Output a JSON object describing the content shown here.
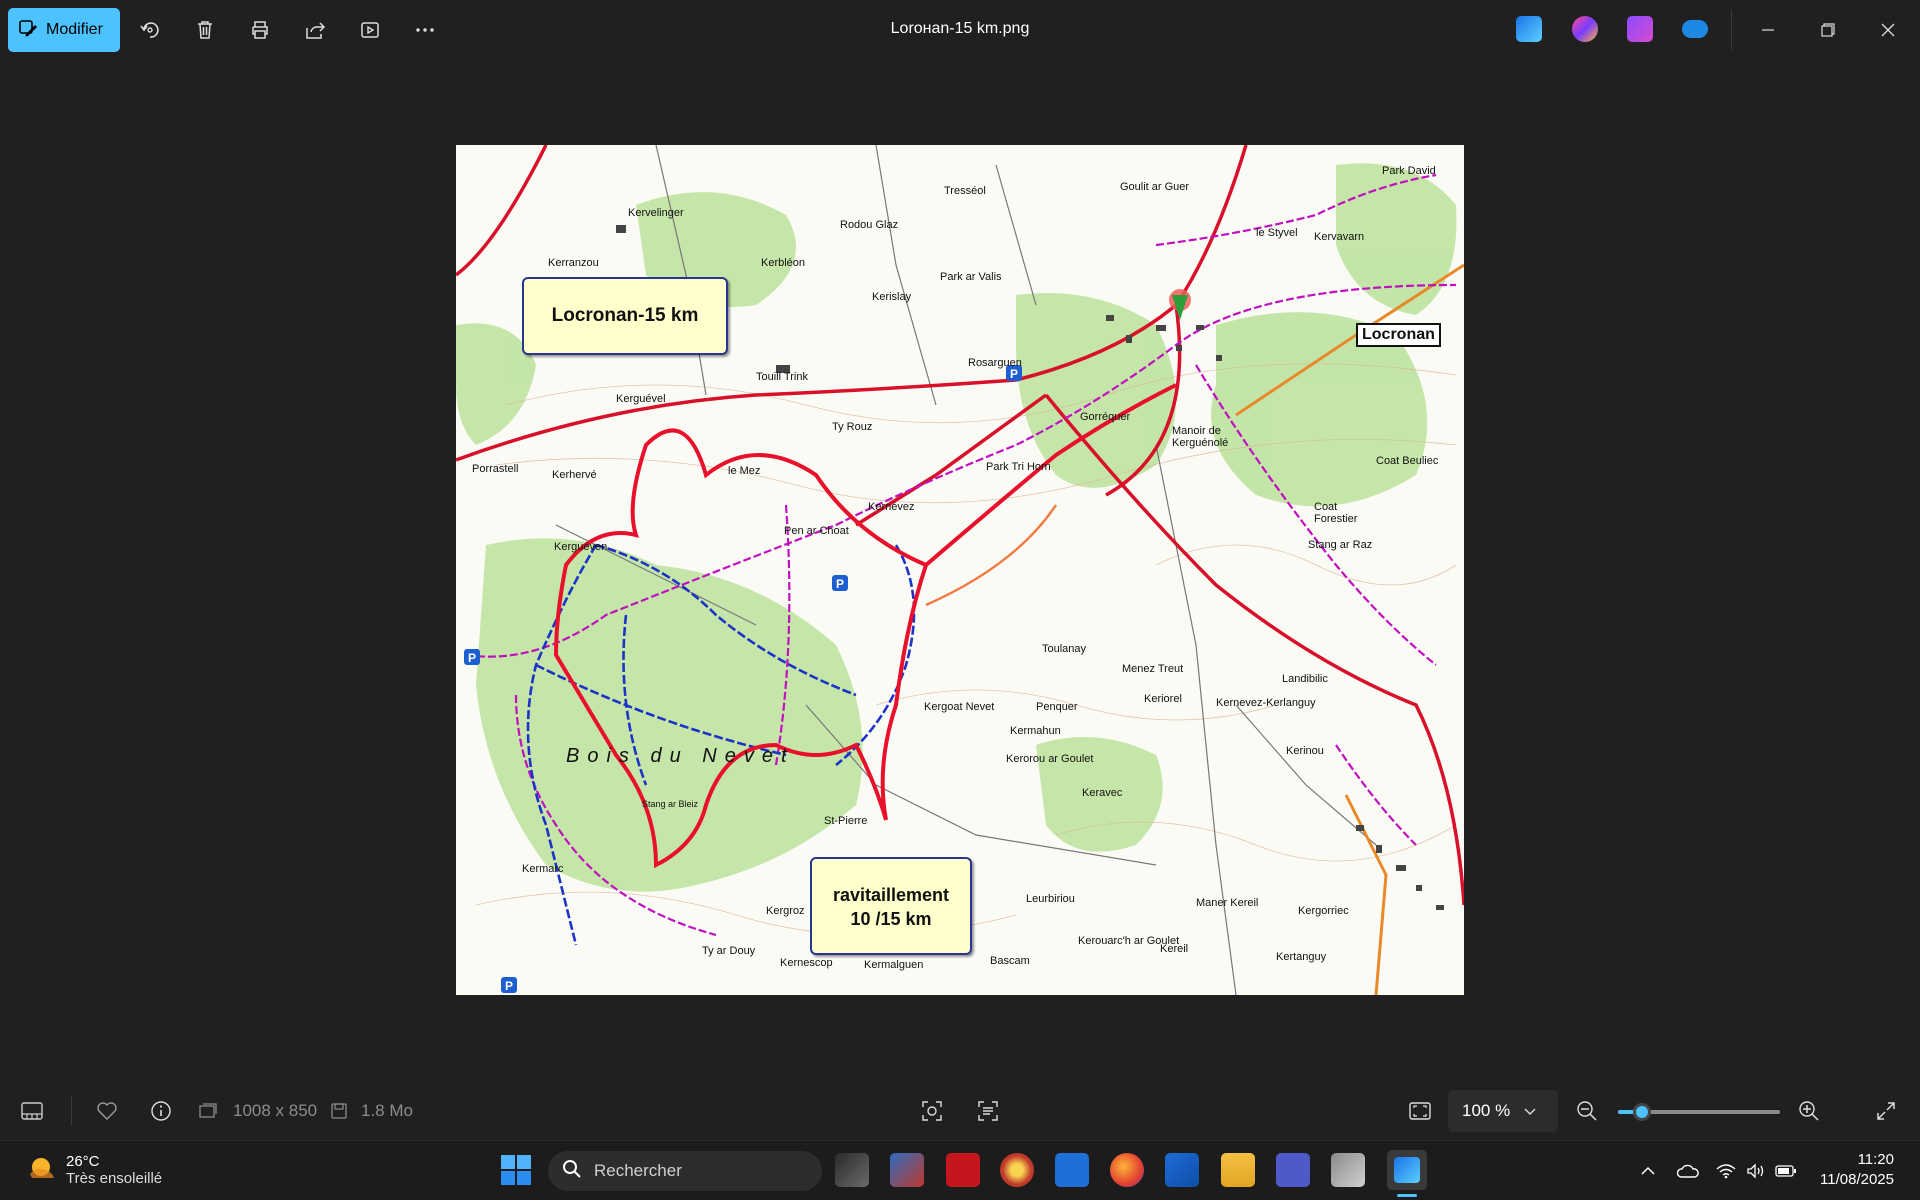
{
  "toolbar": {
    "edit_label": "Modifier",
    "title": "Lorонan-15 km.png"
  },
  "map": {
    "callout_title": "Locronan-15 km",
    "callout_supply_line1": "ravitaillement",
    "callout_supply_line2": "10 /15 km",
    "town_label": "Locronan",
    "forest_label": "Bois du Nevet",
    "places": [
      "Kervelinger",
      "Kerbléon",
      "Rodou Glaz",
      "Tresséol",
      "Goulit ar Guer",
      "Park David",
      "Kervavarn",
      "le Styvel",
      "Kerranzou",
      "Kerislay",
      "Park ar Valis",
      "Rosarguen",
      "Touill Trink",
      "Kerguével",
      "Porrastell",
      "Kerhervé",
      "le Mez",
      "Ty Rouz",
      "Kernévez",
      "Park Tri Horn",
      "Gorréquer",
      "Manoir de Kerguénolé",
      "Kerguéven",
      "Pen ar Choat",
      "Coat Beuliec",
      "Coat Forestier",
      "Stang ar Raz",
      "Toulanay",
      "Menez Treut",
      "Keriorel",
      "Kergoat Nevet",
      "Penquer",
      "Kermahun",
      "Kerorou ar Goulet",
      "Keravec",
      "Landibilic",
      "Kerinou",
      "Kernevez-Kerlanguy",
      "Leurbiriou",
      "Maner Kereil",
      "Kergorriec",
      "Kergroz",
      "Kermalguen",
      "Bascam",
      "Kerouarc'h ar Goulet",
      "Kereil",
      "Kertanguy",
      "Kermarc",
      "Ty ar Douy",
      "Kernescop",
      "St-Pierre",
      "Stang ar Bleiz"
    ]
  },
  "status": {
    "dimensions": "1008 x 850",
    "filesize": "1.8 Mo",
    "zoom": "100 %",
    "zoom_fraction": 0.15
  },
  "taskbar": {
    "temperature": "26°C",
    "condition": "Très ensoleillé",
    "search_placeholder": "Rechercher",
    "time": "11:20",
    "date": "11/08/2025"
  },
  "colors": {
    "accent": "#4cc2ff",
    "route_red": "#e8102a",
    "trail_blue": "#1d33c8",
    "trail_magenta": "#c010c0"
  }
}
